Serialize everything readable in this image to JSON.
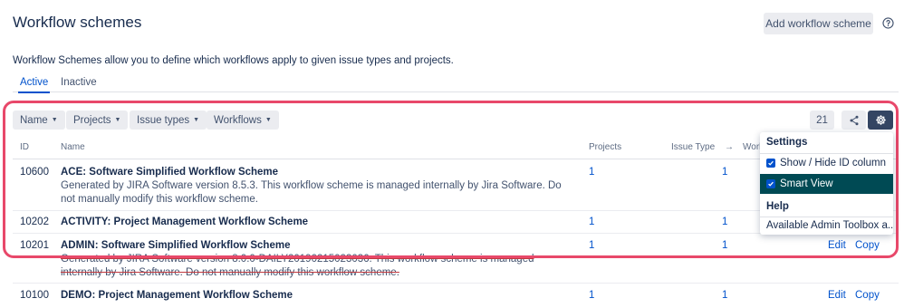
{
  "header": {
    "title": "Workflow schemes",
    "add_button": "Add workflow scheme",
    "help_icon": "question-circle-icon"
  },
  "intro": "Workflow Schemes allow you to define which workflows apply to given issue types and projects.",
  "tabs": [
    {
      "label": "Active",
      "active": true
    },
    {
      "label": "Inactive",
      "active": false
    }
  ],
  "filters": [
    "Name",
    "Projects",
    "Issue types",
    "Workflows"
  ],
  "toolbar": {
    "count": "21",
    "share_icon": "share-icon",
    "settings_icon": "gear-icon"
  },
  "columns": {
    "id": "ID",
    "name": "Name",
    "projects": "Projects",
    "issue_type": "Issue Type",
    "arrow": "→",
    "workflows": "Workfl"
  },
  "rows": [
    {
      "id": "10600",
      "name": "ACE: Software Simplified Workflow Scheme",
      "description": "Generated by JIRA Software version 8.5.3. This workflow scheme is managed internally by Jira Software. Do not manually modify this workflow scheme.",
      "projects": "1",
      "issue_types": "1"
    },
    {
      "id": "10202",
      "name": "ACTIVITY: Project Management Workflow Scheme",
      "description": "",
      "projects": "1",
      "issue_types": "1"
    },
    {
      "id": "10201",
      "name": "ADMIN: Software Simplified Workflow Scheme",
      "description": "Generated by JIRA Software version 8.0.0-DAILY20190215023036. This workflow scheme is managed internally by Jira Software. Do not manually modify this workflow scheme.",
      "projects": "1",
      "issue_types": "1",
      "edit": "Edit",
      "copy": "Copy"
    },
    {
      "id": "10100",
      "name": "DEMO: Project Management Workflow Scheme",
      "description": "",
      "projects": "1",
      "issue_types": "1",
      "edit": "Edit",
      "copy": "Copy"
    }
  ],
  "settings_menu": {
    "settings_heading": "Settings",
    "items": [
      {
        "label": "Show / Hide ID column",
        "checked": true,
        "active": false
      },
      {
        "label": "Smart View",
        "checked": true,
        "active": true
      }
    ],
    "help_heading": "Help",
    "help_item": "Available Admin Toolbox a..."
  },
  "colors": {
    "accent": "#0052cc",
    "highlight_border": "#e8486a",
    "menu_active_bg": "#004a54",
    "gear_button_bg": "#344563"
  }
}
